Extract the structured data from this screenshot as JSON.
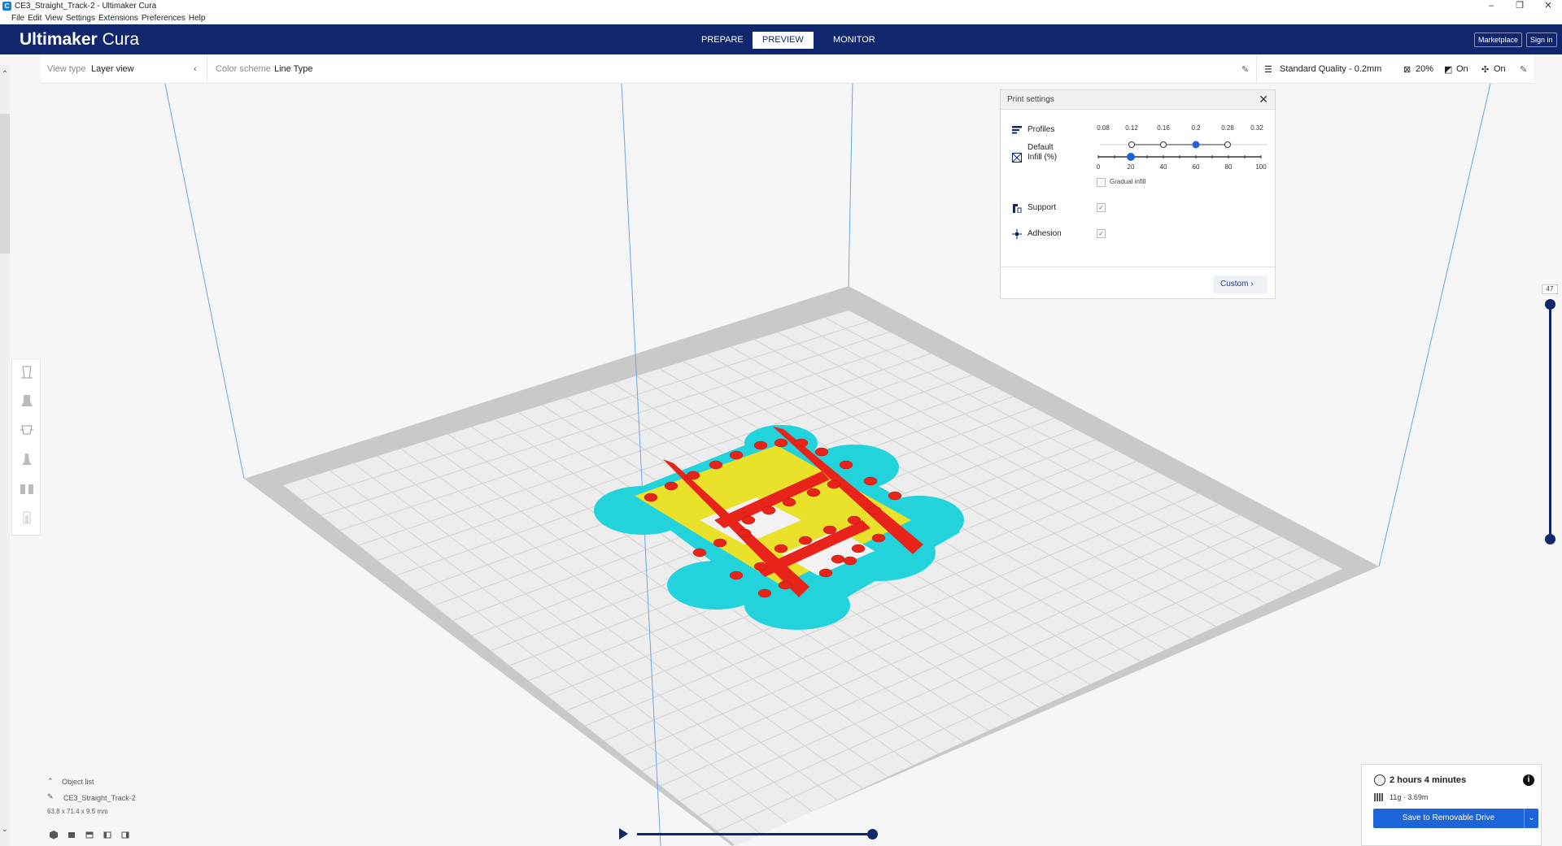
{
  "window": {
    "title": "CE3_Straight_Track-2 - Ultimaker Cura",
    "minimize": "–",
    "restore": "❐",
    "close": "✕"
  },
  "menu": [
    "File",
    "Edit",
    "View",
    "Settings",
    "Extensions",
    "Preferences",
    "Help"
  ],
  "header": {
    "logo_bold": "Ultimaker",
    "logo_light": "Cura",
    "tabs": [
      "PREPARE",
      "PREVIEW",
      "MONITOR"
    ],
    "active_tab": "PREVIEW",
    "marketplace": "Marketplace",
    "sign_in": "Sign in"
  },
  "view_bar": {
    "view_type_label": "View type",
    "view_type_value": "Layer view",
    "color_scheme_label": "Color scheme",
    "color_scheme_value": "Line Type",
    "quality": "Standard Quality - 0.2mm",
    "infill": "20%",
    "support": "On",
    "adhesion": "On"
  },
  "print_settings": {
    "title": "Print settings",
    "profiles_label": "Profiles",
    "profiles_sub": "Default",
    "profile_ticks": [
      "0.08",
      "0.12",
      "0.16",
      "0.2",
      "0.28",
      "0.32"
    ],
    "selected_profile": "0.2",
    "infill_label": "Infill (%)",
    "infill_ticks": [
      "0",
      "20",
      "40",
      "60",
      "80",
      "100"
    ],
    "infill_value": 20,
    "gradual_infill": "Gradual infill",
    "support_label": "Support",
    "support_checked": true,
    "adhesion_label": "Adhesion",
    "adhesion_checked": true,
    "custom_button": "Custom"
  },
  "layer_slider": {
    "top_layer": "47"
  },
  "object_list": {
    "header": "Object list",
    "object_name": "CE3_Straight_Track-2",
    "dimensions": "63.8 x 71.4 x 9.5 mm"
  },
  "output": {
    "time": "2 hours 4 minutes",
    "material": "11g · 3.69m",
    "save_button": "Save to Removable Drive"
  },
  "colors": {
    "header_bg": "#10266d",
    "accent_blue": "#1d64d8",
    "model_red": "#e8231a",
    "model_yellow": "#e9e12a",
    "support_cyan": "#22d3dc"
  }
}
